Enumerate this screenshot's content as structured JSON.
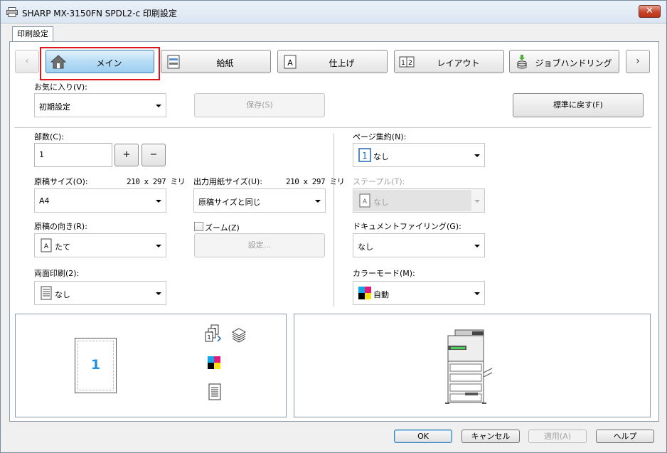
{
  "window": {
    "title": "SHARP MX-3150FN SPDL2-c 印刷設定"
  },
  "outer_tab": {
    "label": "印刷設定"
  },
  "tabs": [
    {
      "label": "メイン",
      "icon": "home-icon",
      "active": true
    },
    {
      "label": "給紙",
      "icon": "paper-tray-icon",
      "active": false
    },
    {
      "label": "仕上げ",
      "icon": "finishing-icon",
      "active": false
    },
    {
      "label": "レイアウト",
      "icon": "layout-icon",
      "active": false
    },
    {
      "label": "ジョブハンドリング",
      "icon": "job-handling-icon",
      "active": false
    }
  ],
  "favorites": {
    "label": "お気に入り(V):",
    "value": "初期設定",
    "save_label": "保存(S)",
    "reset_label": "標準に戻す(F)"
  },
  "copies": {
    "label": "部数(C):",
    "value": "1",
    "plus": "+",
    "minus": "−"
  },
  "original_size": {
    "label": "原稿サイズ(O):",
    "dims": "210 x 297 ミリ",
    "value": "A4"
  },
  "output_size": {
    "label": "出力用紙サイズ(U):",
    "dims": "210 x 297 ミリ",
    "value": "原稿サイズと同じ"
  },
  "orientation": {
    "label": "原稿の向き(R):",
    "value": "たて"
  },
  "zoom": {
    "label": "ズーム(Z)",
    "settings_label": "設定..."
  },
  "duplex": {
    "label": "両面印刷(2):",
    "value": "なし"
  },
  "pages_per_sheet": {
    "label": "ページ集約(N):",
    "value": "なし"
  },
  "staple": {
    "label": "ステープル(T):",
    "value": "なし"
  },
  "document_filing": {
    "label": "ドキュメントファイリング(G):",
    "value": "なし"
  },
  "color_mode": {
    "label": "カラーモード(M):",
    "value": "自動"
  },
  "preview": {
    "page_number": "1"
  },
  "footer": {
    "ok": "OK",
    "cancel": "キャンセル",
    "apply": "適用(A)",
    "help": "ヘルプ"
  },
  "colors": {
    "active_tab": "#9ccff0",
    "highlight_outline": "#e0141b",
    "close_button": "#c7452b",
    "page_number": "#1e8fe0"
  }
}
